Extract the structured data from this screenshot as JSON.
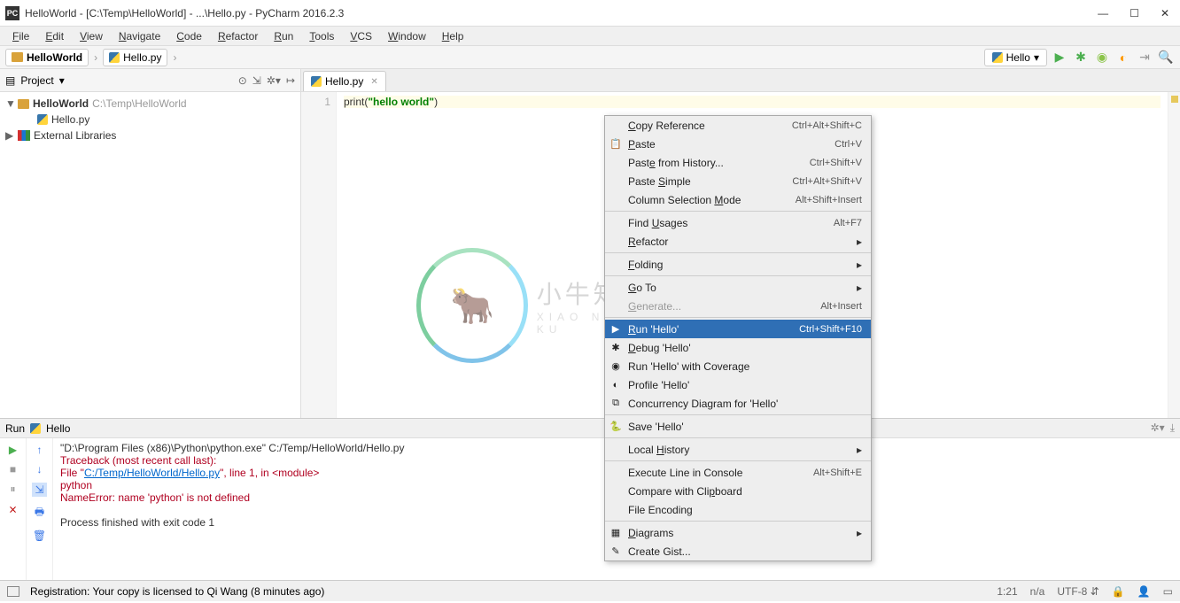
{
  "titlebar": {
    "app_icon_text": "PC",
    "title": "HelloWorld - [C:\\Temp\\HelloWorld] - ...\\Hello.py - PyCharm 2016.2.3"
  },
  "menu": [
    "File",
    "Edit",
    "View",
    "Navigate",
    "Code",
    "Refactor",
    "Run",
    "Tools",
    "VCS",
    "Window",
    "Help"
  ],
  "breadcrumb": [
    {
      "label": "HelloWorld",
      "icon": "folder"
    },
    {
      "label": "Hello.py",
      "icon": "py"
    }
  ],
  "run_config": {
    "label": "Hello"
  },
  "project_panel": {
    "title": "Project",
    "tree": {
      "root": {
        "label": "HelloWorld",
        "path": "C:\\Temp\\HelloWorld",
        "bold": true
      },
      "child": {
        "label": "Hello.py"
      },
      "libs": {
        "label": "External Libraries"
      }
    }
  },
  "editor": {
    "tab": "Hello.py",
    "line_no": "1",
    "code_tokens": {
      "fn": "print",
      "open": "(",
      "q1": "\"",
      "str": "hello world",
      "q2": "\"",
      "close": ")"
    }
  },
  "context_menu": [
    {
      "label": "Copy Reference",
      "shortcut": "Ctrl+Alt+Shift+C",
      "u": 0
    },
    {
      "label": "Paste",
      "shortcut": "Ctrl+V",
      "icon": "paste",
      "u": 0
    },
    {
      "label": "Paste from History...",
      "shortcut": "Ctrl+Shift+V",
      "u": 4
    },
    {
      "label": "Paste Simple",
      "shortcut": "Ctrl+Alt+Shift+V",
      "u": 6
    },
    {
      "label": "Column Selection Mode",
      "shortcut": "Alt+Shift+Insert",
      "u": 17
    },
    {
      "sep": true
    },
    {
      "label": "Find Usages",
      "shortcut": "Alt+F7",
      "u": 5
    },
    {
      "label": "Refactor",
      "submenu": true,
      "u": 0
    },
    {
      "sep": true
    },
    {
      "label": "Folding",
      "submenu": true,
      "u": 0
    },
    {
      "sep": true
    },
    {
      "label": "Go To",
      "submenu": true,
      "u": 0
    },
    {
      "label": "Generate...",
      "shortcut": "Alt+Insert",
      "disabled": true,
      "u": 0
    },
    {
      "sep": true
    },
    {
      "label": "Run 'Hello'",
      "shortcut": "Ctrl+Shift+F10",
      "icon": "run",
      "selected": true,
      "u": 0
    },
    {
      "label": "Debug 'Hello'",
      "icon": "debug",
      "u": 0
    },
    {
      "label": "Run 'Hello' with Coverage",
      "icon": "coverage"
    },
    {
      "label": "Profile 'Hello'",
      "icon": "profile"
    },
    {
      "label": "Concurrency Diagram for  'Hello'",
      "icon": "concurrency"
    },
    {
      "sep": true
    },
    {
      "label": "Save 'Hello'",
      "icon": "py"
    },
    {
      "sep": true
    },
    {
      "label": "Local History",
      "submenu": true,
      "u": 6
    },
    {
      "sep": true
    },
    {
      "label": "Execute Line in Console",
      "shortcut": "Alt+Shift+E"
    },
    {
      "label": "Compare with Clipboard",
      "u": 16
    },
    {
      "label": "File Encoding"
    },
    {
      "sep": true
    },
    {
      "label": "Diagrams",
      "submenu": true,
      "icon": "diagrams",
      "u": 0
    },
    {
      "label": "Create Gist...",
      "icon": "gist"
    }
  ],
  "run_panel": {
    "title_left": "Run",
    "title_script": "Hello",
    "lines": {
      "cmd": "\"D:\\Program Files (x86)\\Python\\python.exe\" C:/Temp/HelloWorld/Hello.py",
      "tb": "Traceback (most recent call last):",
      "file_pre": "  File \"",
      "file_link": "C:/Temp/HelloWorld/Hello.py",
      "file_post": "\", line 1, in <module>",
      "indent": "    python",
      "err": "NameError: name 'python' is not defined",
      "exit": "Process finished with exit code 1"
    }
  },
  "statusbar": {
    "reg": "Registration: Your copy is licensed to Qi Wang (8 minutes ago)",
    "pos": "1:21",
    "na": "n/a",
    "enc": "UTF-8"
  },
  "watermark": {
    "main": "小牛知识库",
    "sub": "XIAO NIU ZHI SHI KU"
  }
}
